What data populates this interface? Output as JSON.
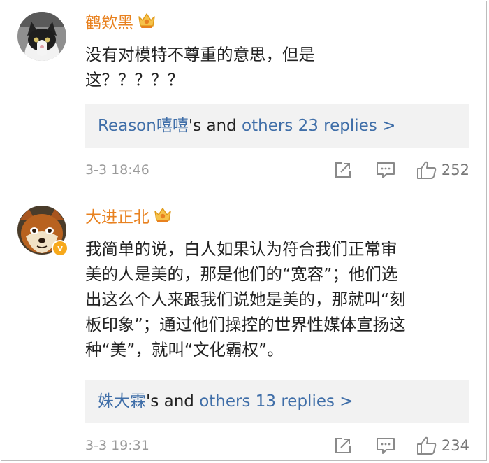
{
  "comments": [
    {
      "username": "鹤欸黑",
      "text": "没有对模特不尊重的意思，但是\n这？？？？？",
      "replies": {
        "first_user": "Reason嘻嘻",
        "connector": "'s and ",
        "others": "others 23 replies >"
      },
      "time": "3-3 18:46",
      "likes": "252",
      "avatar_icon": "cat-avatar-icon"
    },
    {
      "username": "大进正北",
      "verified_badge": "v",
      "text": "我简单的说，白人如果认为符合我们正常审\n美的人是美的，那是他们的“宽容”；他们选\n出这么个人来跟我们说她是美的，那就叫“刻\n板印象”；通过他们操控的世界性媒体宣扬这\n种“美”，就叫“文化霸权”。",
      "replies": {
        "first_user": "姝大霖",
        "connector": "'s and ",
        "others": "others 13 replies >"
      },
      "time": "3-3 19:31",
      "likes": "234",
      "avatar_icon": "fox-avatar-icon"
    }
  ],
  "colors": {
    "username": "#e8811f",
    "link": "#3f6ea8",
    "meta": "#9a9a9a",
    "reply_bg": "#f2f2f2"
  }
}
